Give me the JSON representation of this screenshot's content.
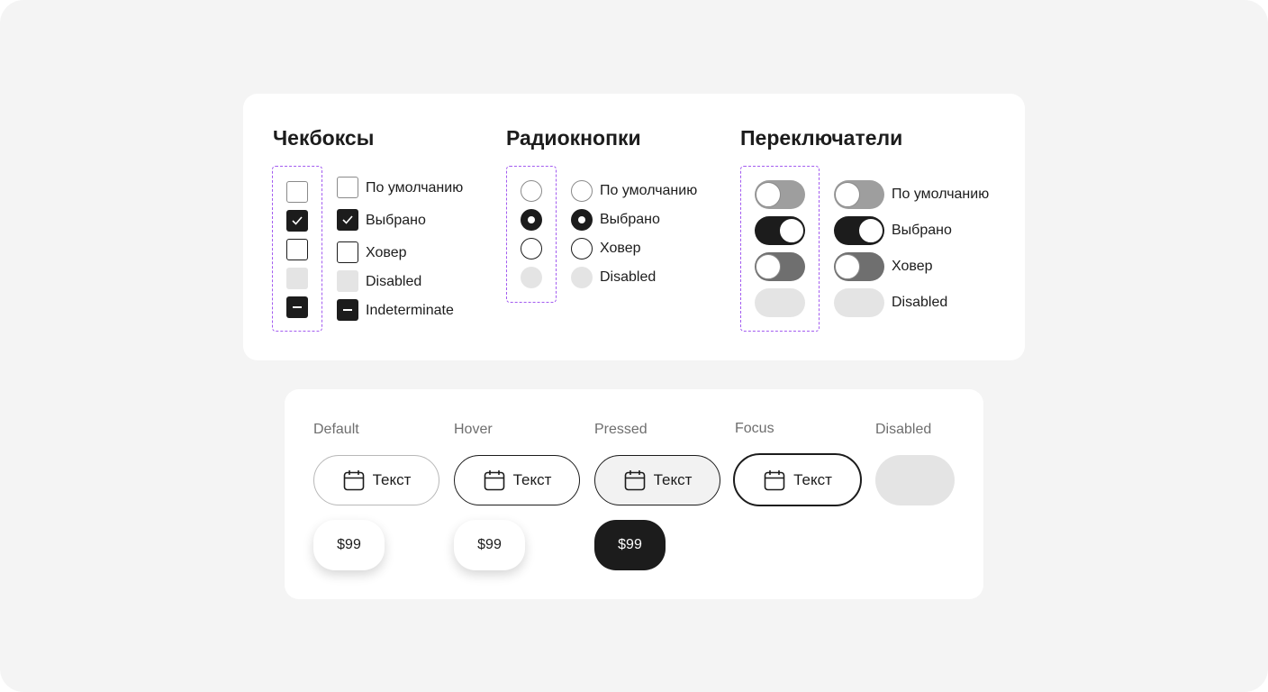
{
  "selection_controls": {
    "checkboxes": {
      "title": "Чекбоксы",
      "labels": [
        "По умолчанию",
        "Выбрано",
        "Ховер",
        "Disabled",
        "Indeterminate"
      ]
    },
    "radios": {
      "title": "Радиокнопки",
      "labels": [
        "По умолчанию",
        "Выбрано",
        "Ховер",
        "Disabled"
      ]
    },
    "toggles": {
      "title": "Переключатели",
      "labels": [
        "По умолчанию",
        "Выбрано",
        "Ховер",
        "Disabled"
      ]
    }
  },
  "buttons": {
    "states": [
      "Default",
      "Hover",
      "Pressed",
      "Focus",
      "Disabled"
    ],
    "button_text": "Текст",
    "button_icon": "calendar-icon",
    "price_label": "$99"
  },
  "colors": {
    "accent_dashed": "#a35cf0",
    "dark": "#1c1c1c",
    "disabled": "#e4e4e4",
    "background": "#f4f4f4"
  }
}
